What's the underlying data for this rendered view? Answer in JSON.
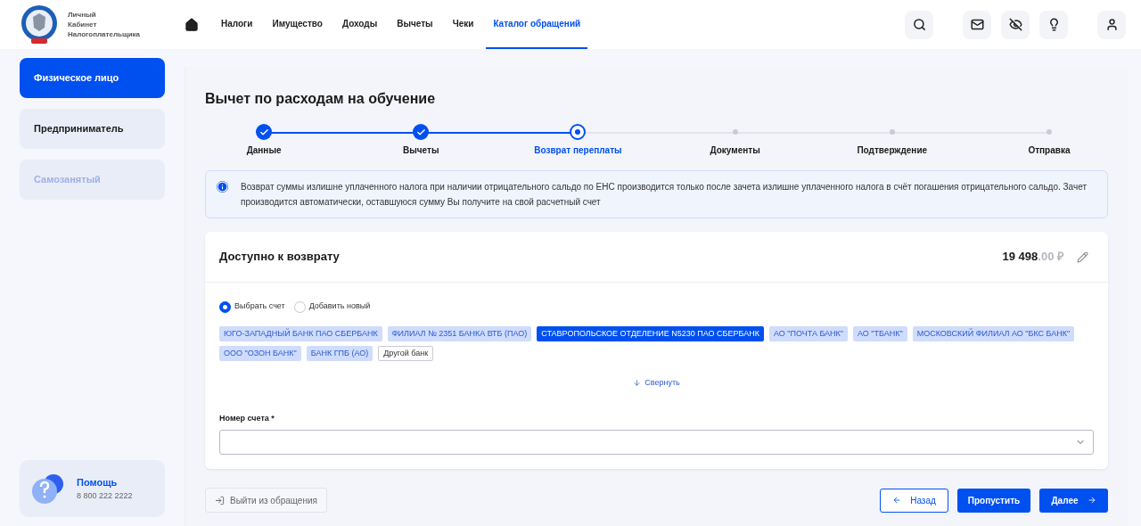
{
  "header": {
    "logo_lines": [
      "Личный",
      "Кабинет",
      "Налогоплательщика"
    ],
    "nav": [
      {
        "label": "Налоги",
        "selected": false
      },
      {
        "label": "Имущество",
        "selected": false
      },
      {
        "label": "Доходы",
        "selected": false
      },
      {
        "label": "Вычеты",
        "selected": false
      },
      {
        "label": "Чеки",
        "selected": false
      },
      {
        "label": "Каталог обращений",
        "selected": true
      }
    ]
  },
  "sidebar": {
    "items": [
      {
        "label": "Физическое лицо",
        "selected": true,
        "disabled": false
      },
      {
        "label": "Предприниматель",
        "selected": false,
        "disabled": false
      },
      {
        "label": "Самозанятый",
        "selected": false,
        "disabled": true
      }
    ],
    "help": {
      "title": "Помощь",
      "phone": "8 800 222 2222"
    }
  },
  "page_title": "Вычет по расходам на обучение",
  "steps": [
    {
      "label": "Данные",
      "completed": true,
      "selected": false
    },
    {
      "label": "Вычеты",
      "completed": true,
      "selected": false
    },
    {
      "label": "Возврат переплаты",
      "completed": false,
      "selected": true
    },
    {
      "label": "Документы",
      "completed": false,
      "selected": false
    },
    {
      "label": "Подтверждение",
      "completed": false,
      "selected": false
    },
    {
      "label": "Отправка",
      "completed": false,
      "selected": false
    }
  ],
  "info": "Возврат суммы излишне уплаченного налога при наличии отрицательного сальдо по ЕНС производится только после зачета излишне уплаченного налога в счёт погашения отрицательного сальдо. Зачет производится автоматически, оставшуюся сумму Вы получите на свой расчетный счет",
  "card": {
    "title": "Доступно к возврату",
    "amount": "19 498",
    "amount_fraction": ".00 ₽",
    "options": [
      {
        "label": "Выбрать счет",
        "selected": true
      },
      {
        "label": "Добавить новый",
        "selected": false
      }
    ],
    "banks": [
      {
        "label": "ЮГО-ЗАПАДНЫЙ БАНК ПАО СБЕРБАНК",
        "selected": false,
        "kind": "bank"
      },
      {
        "label": "ФИЛИАЛ № 2351 БАНКА ВТБ (ПАО)",
        "selected": false,
        "kind": "bank"
      },
      {
        "label": "СТАВРОПОЛЬСКОЕ ОТДЕЛЕНИЕ N5230 ПАО СБЕРБАНК",
        "selected": true,
        "kind": "bank"
      },
      {
        "label": "АО \"ПОЧТА БАНК\"",
        "selected": false,
        "kind": "bank"
      },
      {
        "label": "АО \"ТБАНК\"",
        "selected": false,
        "kind": "bank"
      },
      {
        "label": "МОСКОВСКИЙ ФИЛИАЛ АО \"БКС БАНК\"",
        "selected": false,
        "kind": "bank"
      },
      {
        "label": "ООО \"ОЗОН БАНК\"",
        "selected": false,
        "kind": "bank"
      },
      {
        "label": "БАНК ГПБ (АО)",
        "selected": false,
        "kind": "bank"
      },
      {
        "label": "Другой банк",
        "selected": false,
        "kind": "other"
      }
    ],
    "collapse": "Свернуть",
    "account_label": "Номер счета *"
  },
  "footer": {
    "exit": "Выйти из обращения",
    "back": "Назад",
    "skip": "Пропустить",
    "next": "Далее"
  }
}
